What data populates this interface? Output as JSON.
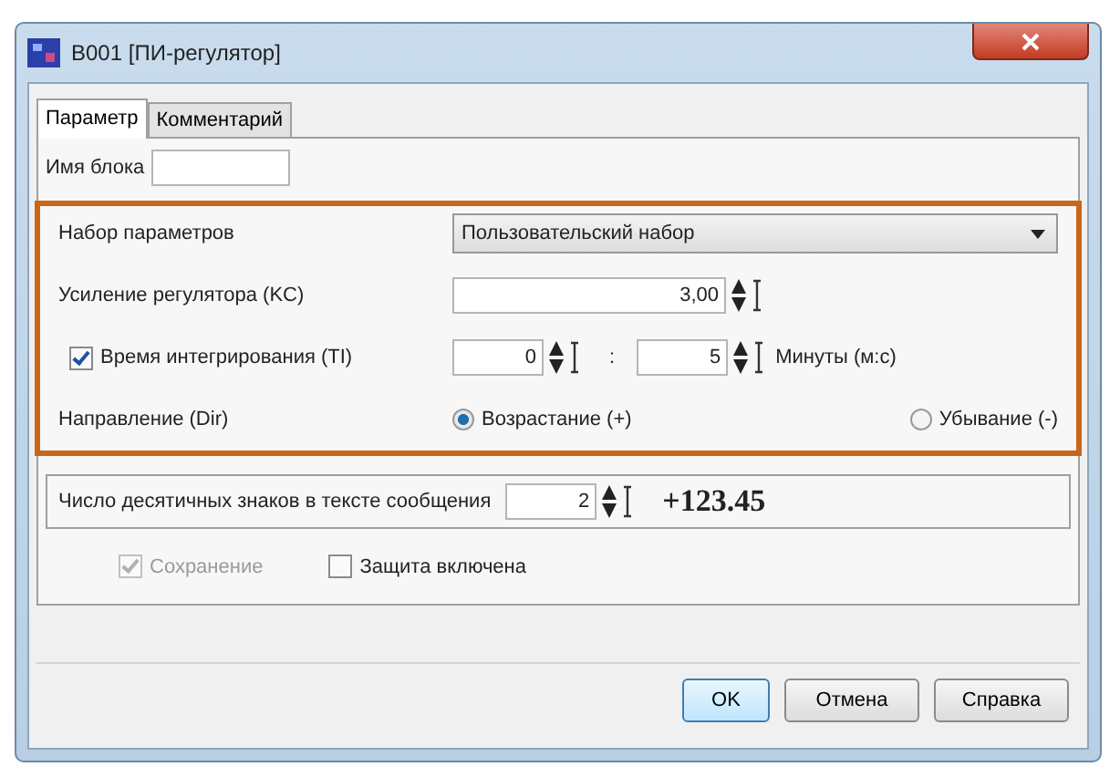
{
  "window": {
    "title": "B001 [ПИ-регулятор]"
  },
  "tabs": [
    {
      "label": "Параметр",
      "selected": true
    },
    {
      "label": "Комментарий",
      "selected": false
    }
  ],
  "block_name": {
    "label": "Имя блока"
  },
  "parameter_set": {
    "label": "Набор параметров",
    "value": "Пользовательский набор"
  },
  "gain": {
    "label": "Усиление регулятора (KC)",
    "value": "3,00"
  },
  "integration": {
    "label": "Время интегрирования (TI)",
    "checked": true,
    "minutes": "0",
    "separator": ":",
    "seconds": "5",
    "unit": "Минуты (м:с)"
  },
  "direction": {
    "label": "Направление (Dir)",
    "options": [
      {
        "label": "Возрастание (+)",
        "selected": true
      },
      {
        "label": "Убывание (-)",
        "selected": false
      }
    ]
  },
  "decimals": {
    "label": "Число десятичных знаков в тексте сообщения",
    "value": "2",
    "preview": "+123.45"
  },
  "options": [
    {
      "label": "Сохранение",
      "checked": true,
      "disabled": true
    },
    {
      "label": "Защита включена",
      "checked": false,
      "disabled": false
    }
  ],
  "buttons": [
    {
      "label": "OK",
      "default": true
    },
    {
      "label": "Отмена",
      "default": false
    },
    {
      "label": "Справка",
      "default": false
    }
  ]
}
